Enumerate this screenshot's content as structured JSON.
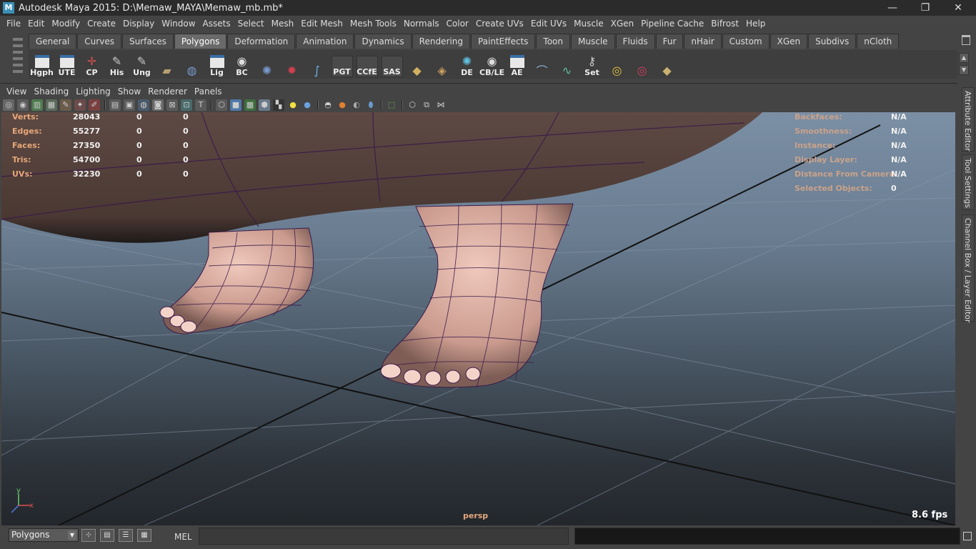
{
  "window": {
    "title": "Autodesk Maya 2015: D:\\Memaw_MAYA\\Memaw_mb.mb*",
    "app_icon": "M",
    "minimize": "—",
    "maximize": "❐",
    "close": "✕"
  },
  "menubar": [
    "File",
    "Edit",
    "Modify",
    "Create",
    "Display",
    "Window",
    "Assets",
    "Select",
    "Mesh",
    "Edit Mesh",
    "Mesh Tools",
    "Normals",
    "Color",
    "Create UVs",
    "Edit UVs",
    "Muscle",
    "XGen",
    "Pipeline Cache",
    "Bifrost",
    "Help"
  ],
  "shelf": {
    "tabs": [
      "General",
      "Curves",
      "Surfaces",
      "Polygons",
      "Deformation",
      "Animation",
      "Dynamics",
      "Rendering",
      "PaintEffects",
      "Toon",
      "Muscle",
      "Fluids",
      "Fur",
      "nHair",
      "Custom",
      "XGen",
      "Subdivs",
      "nCloth"
    ],
    "active_tab": "Polygons",
    "buttons": [
      "Hgph",
      "UTE",
      "CP",
      "His",
      "Ung",
      "",
      "",
      "Lig",
      "BC",
      "",
      "",
      "",
      "PGT",
      "CCfE",
      "SAS",
      "",
      "",
      "DE",
      "CB/LE",
      "AE",
      "",
      "",
      "Set",
      "",
      "",
      ""
    ]
  },
  "panel_menu": [
    "View",
    "Shading",
    "Lighting",
    "Show",
    "Renderer",
    "Panels"
  ],
  "hud_left": [
    {
      "label": "Verts:",
      "v1": "28043",
      "v2": "0",
      "v3": "0"
    },
    {
      "label": "Edges:",
      "v1": "55277",
      "v2": "0",
      "v3": "0"
    },
    {
      "label": "Faces:",
      "v1": "27350",
      "v2": "0",
      "v3": "0"
    },
    {
      "label": "Tris:",
      "v1": "54700",
      "v2": "0",
      "v3": "0"
    },
    {
      "label": "UVs:",
      "v1": "32230",
      "v2": "0",
      "v3": "0"
    }
  ],
  "hud_right": [
    {
      "label": "Backfaces:",
      "value": "N/A"
    },
    {
      "label": "Smoothness:",
      "value": "N/A"
    },
    {
      "label": "Instance:",
      "value": "N/A"
    },
    {
      "label": "Display Layer:",
      "value": "N/A"
    },
    {
      "label": "Distance From Camera:",
      "value": "N/A"
    },
    {
      "label": "Selected Objects:",
      "value": "0"
    }
  ],
  "camera_label": "persp",
  "fps": "8.6 fps",
  "axis": {
    "y": "y",
    "x": "x"
  },
  "side_tabs": [
    "Attribute Editor",
    "Tool Settings",
    "Channel Box / Layer Editor"
  ],
  "cmdline": {
    "mode": "Polygons",
    "mel_label": "MEL"
  }
}
